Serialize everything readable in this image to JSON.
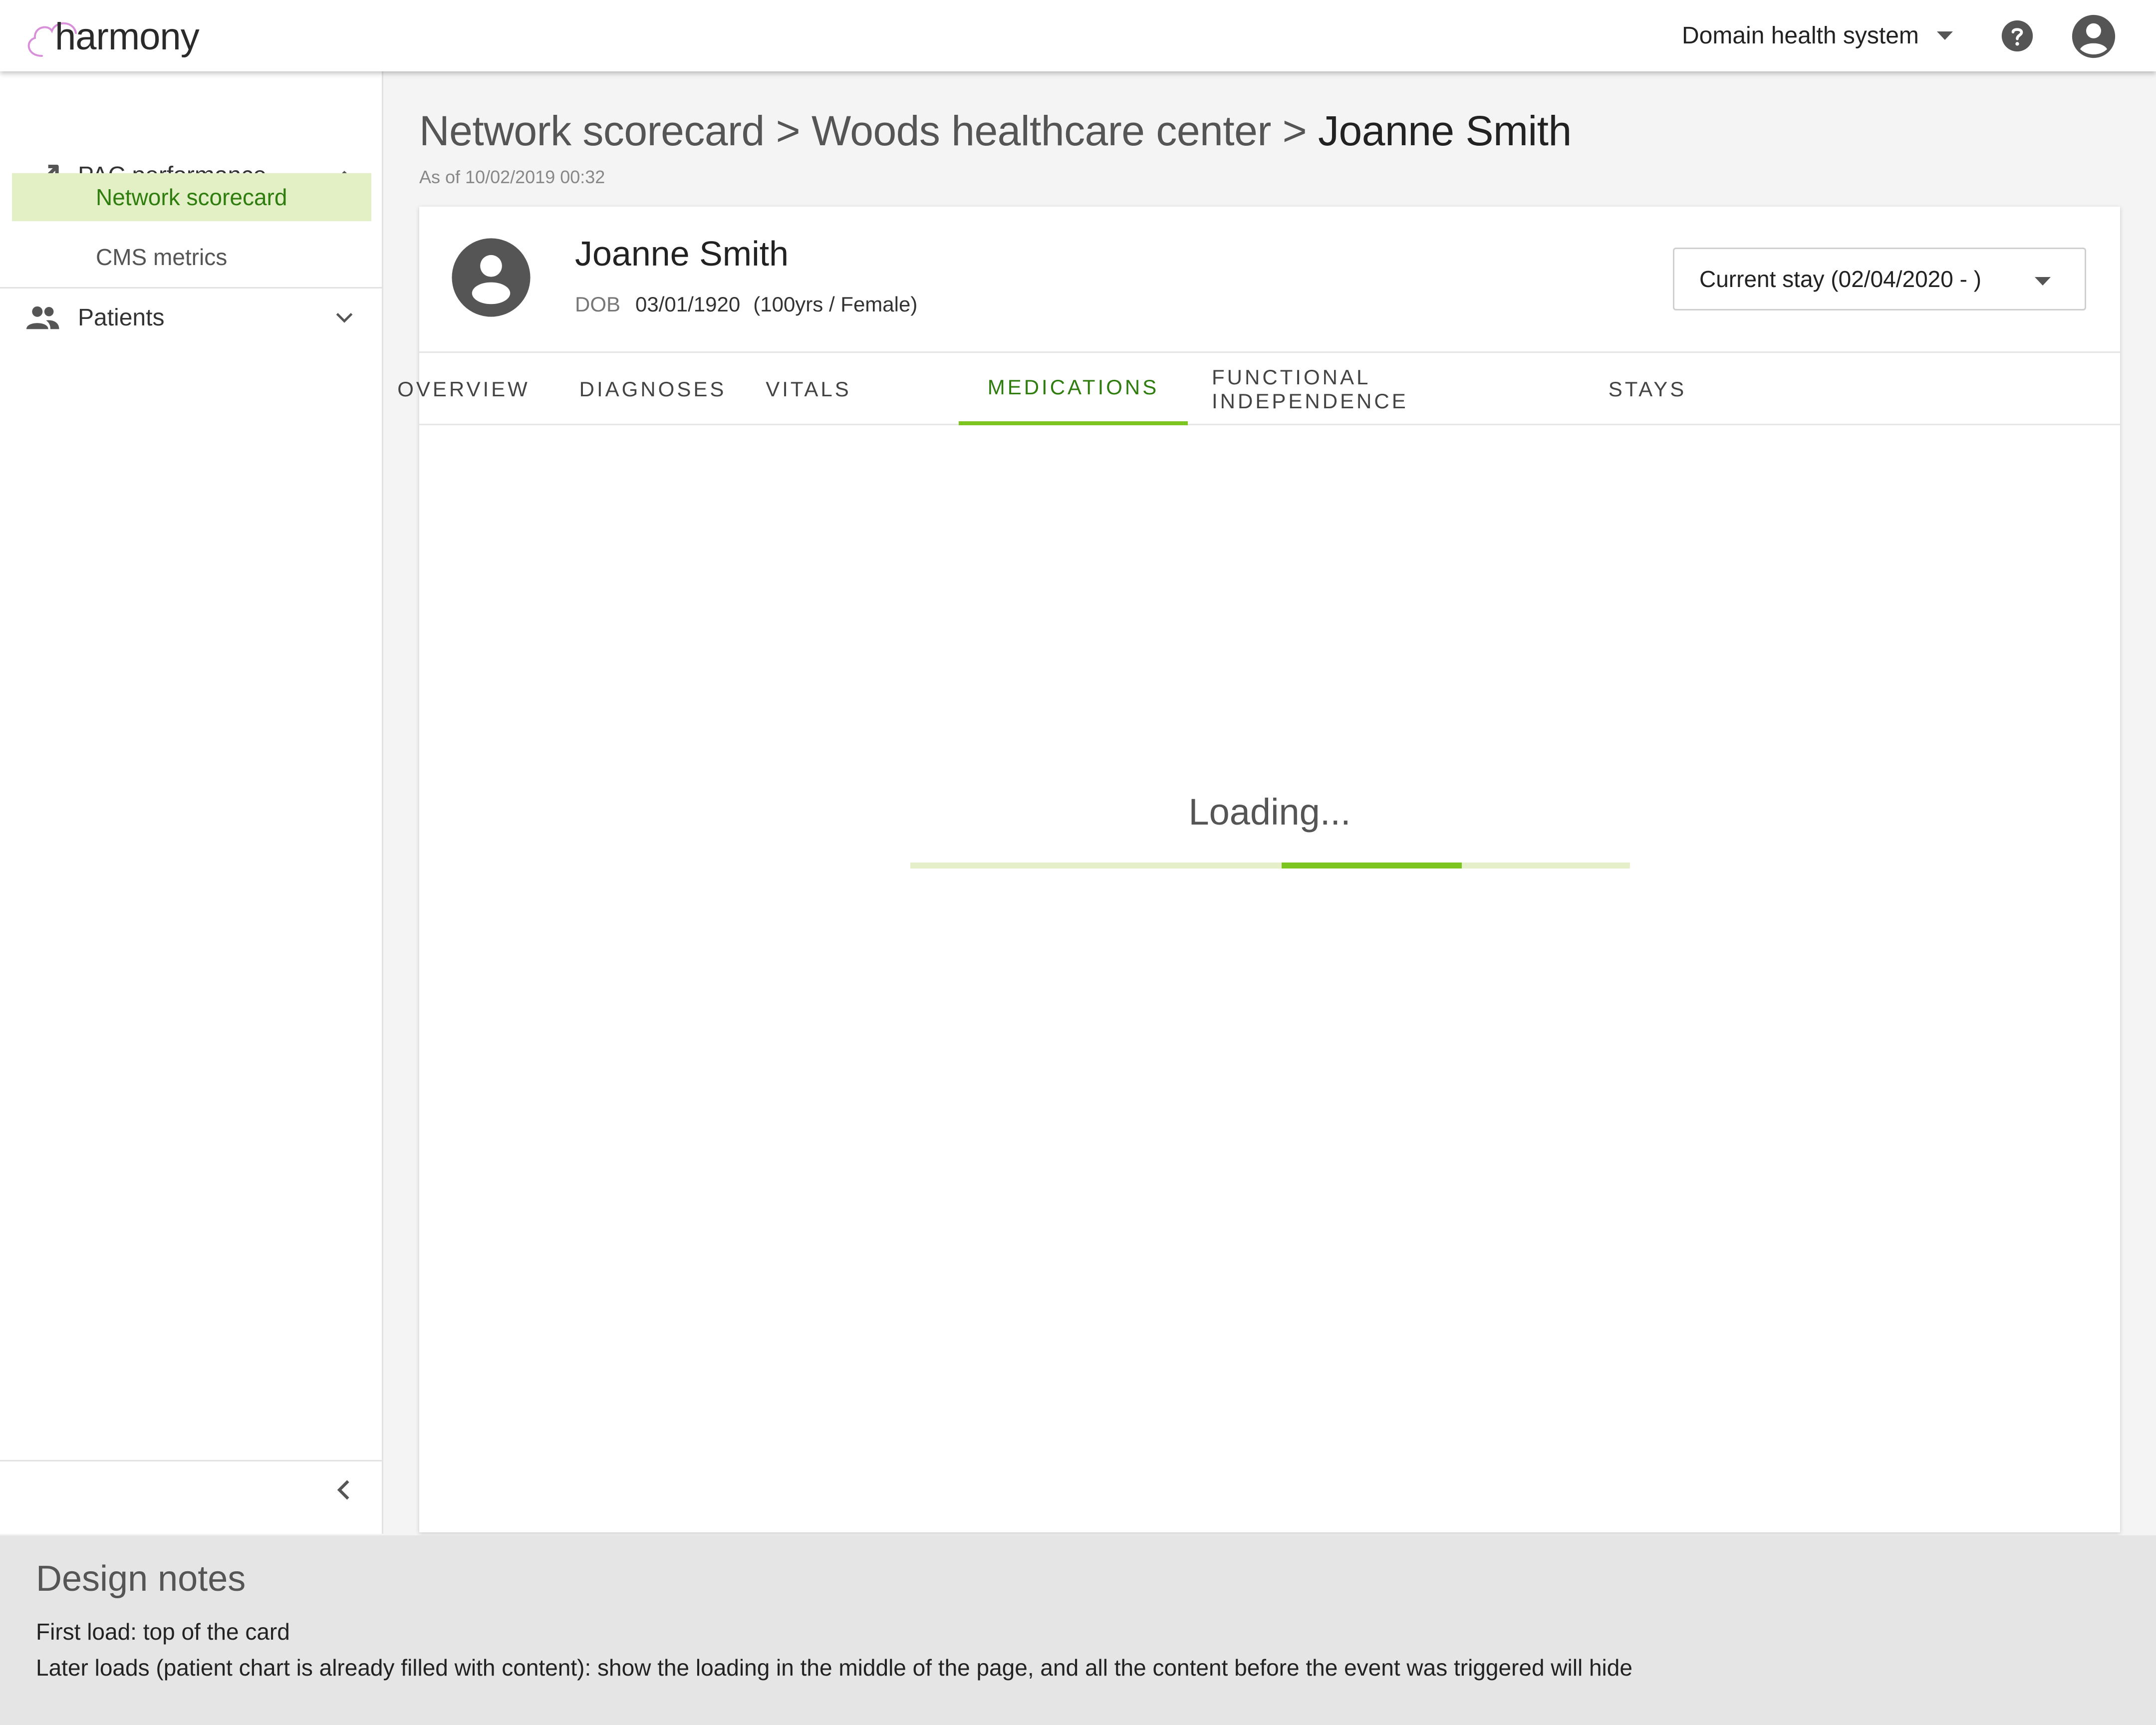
{
  "brand": {
    "name": "harmony",
    "accent": "#7cc420",
    "accent_dark": "#2f7d0f",
    "logo_outline": "#d98fd9"
  },
  "header": {
    "org_selector": {
      "label": "Domain health system",
      "icon": "caret-down-icon"
    },
    "help_icon": "help-circle-icon",
    "account_icon": "account-circle-icon"
  },
  "sidebar": {
    "groups": [
      {
        "label": "PAC performance",
        "icon": "trending-up-icon",
        "expanded": true,
        "items": [
          {
            "label": "Network scorecard",
            "active": true
          },
          {
            "label": "CMS metrics",
            "active": false
          }
        ]
      },
      {
        "label": "Patients",
        "icon": "people-icon",
        "expanded": false,
        "items": []
      }
    ],
    "collapse_icon": "chevron-left-icon"
  },
  "breadcrumb": {
    "items": [
      "Network scorecard",
      "Woods healthcare center",
      "Joanne Smith"
    ],
    "separator": ">"
  },
  "as_of": "As of 10/02/2019 00:32",
  "patient": {
    "name": "Joanne Smith",
    "dob_label": "DOB",
    "dob": "03/01/1920",
    "age_sex": "(100yrs / Female)",
    "avatar_icon": "account-circle-icon"
  },
  "stay_selector": {
    "label": "Current stay (02/04/2020 - )"
  },
  "tabs": [
    {
      "label": "OVERVIEW",
      "active": false
    },
    {
      "label": "DIAGNOSES",
      "active": false
    },
    {
      "label": "VITALS",
      "active": false
    },
    {
      "label": "MEDICATIONS",
      "active": true
    },
    {
      "label": "FUNCTIONAL INDEPENDENCE",
      "active": false
    },
    {
      "label": "STAYS",
      "active": false
    }
  ],
  "loading": {
    "text": "Loading...",
    "progress_start_fraction": 0.516,
    "progress_end_fraction": 0.766
  },
  "design_notes": {
    "title": "Design notes",
    "lines": [
      "First load: top of the card",
      "Later loads (patient chart is already filled with content): show the loading in the middle of the page, and all the content before the event was triggered will hide"
    ]
  }
}
